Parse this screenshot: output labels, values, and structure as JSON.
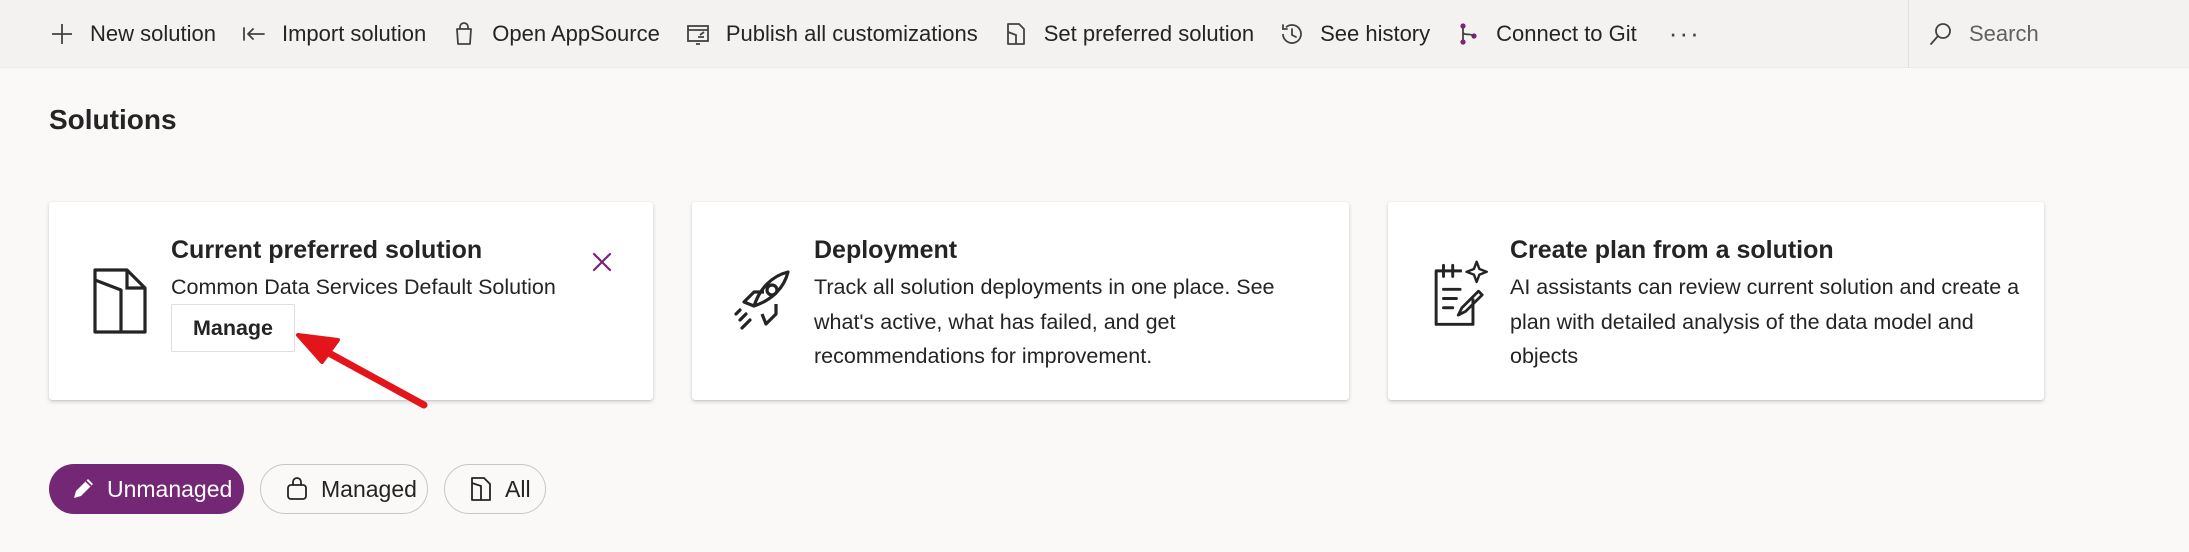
{
  "toolbar": {
    "items": [
      {
        "label": "New solution",
        "icon": "plus-icon"
      },
      {
        "label": "Import solution",
        "icon": "import-arrow-icon"
      },
      {
        "label": "Open AppSource",
        "icon": "shopping-bag-icon"
      },
      {
        "label": "Publish all customizations",
        "icon": "publish-icon"
      },
      {
        "label": "Set preferred solution",
        "icon": "document-folder-icon"
      },
      {
        "label": "See history",
        "icon": "history-icon"
      },
      {
        "label": "Connect to Git",
        "icon": "git-branch-icon"
      }
    ],
    "more_label": "···",
    "search_placeholder": "Search"
  },
  "page": {
    "title": "Solutions"
  },
  "cards": {
    "preferred": {
      "title": "Current preferred solution",
      "subtitle": "Common Data Services Default Solution",
      "button_label": "Manage",
      "icon": "document-folder-icon"
    },
    "deployment": {
      "title": "Deployment",
      "description": "Track all solution deployments in one place. See what's active, what has failed, and get recommendations for improvement.",
      "icon": "rocket-icon"
    },
    "plan": {
      "title": "Create plan from a solution",
      "description": "AI assistants can review current solution and create a plan with detailed analysis of the data model and objects",
      "icon": "sparkle-document-icon"
    }
  },
  "filters": {
    "items": [
      {
        "label": "Unmanaged",
        "icon": "pencil-icon",
        "active": true
      },
      {
        "label": "Managed",
        "icon": "lock-bag-icon",
        "active": false
      },
      {
        "label": "All",
        "icon": "document-folder-icon",
        "active": false
      }
    ]
  },
  "colors": {
    "accent": "#742774",
    "annotation_arrow": "#e3151a"
  }
}
